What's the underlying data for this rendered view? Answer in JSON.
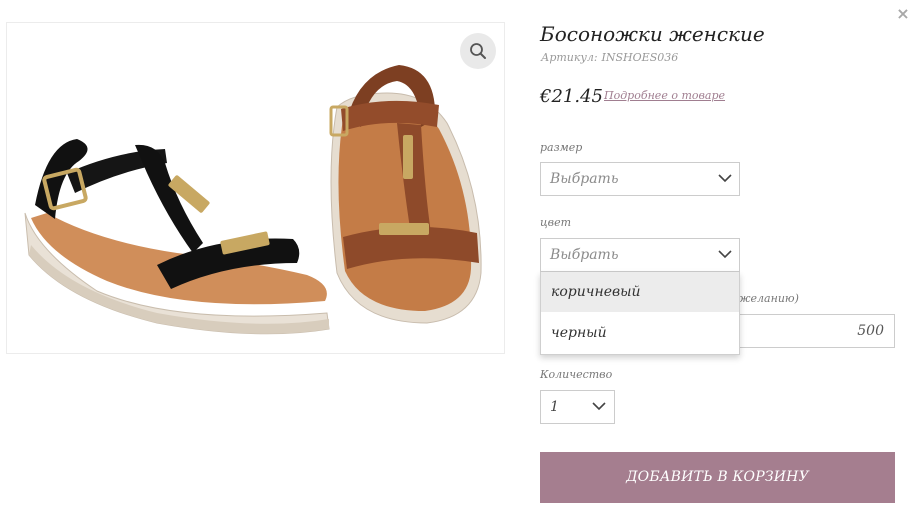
{
  "close": {
    "icon": "close-icon",
    "label": "×"
  },
  "gallery": {
    "image_alt": "sandals-photo",
    "zoom_icon": "search-icon"
  },
  "product": {
    "title": "Босоножки женские",
    "sku_label": "Артикул:",
    "sku_value": "INSHOES036",
    "price": "€21.45",
    "details_link": "Подробнее о товаре"
  },
  "size": {
    "label": "размер",
    "value": "Выбрать"
  },
  "color": {
    "label": "цвет",
    "value": "Выбрать",
    "options": [
      "коричневый",
      "черный"
    ],
    "highlighted_option": 0
  },
  "personalization": {
    "label_tail": "желанию)",
    "value": "500"
  },
  "quantity": {
    "label": "Количество",
    "value": "1"
  },
  "cart": {
    "button": "ДОБАВИТЬ В КОРЗИНУ"
  },
  "colors": {
    "accent": "#a57e8f",
    "link": "#a07e90",
    "border": "#cccccc",
    "option_hover": "#ececec",
    "zoom_bg": "#e9e9e9"
  }
}
